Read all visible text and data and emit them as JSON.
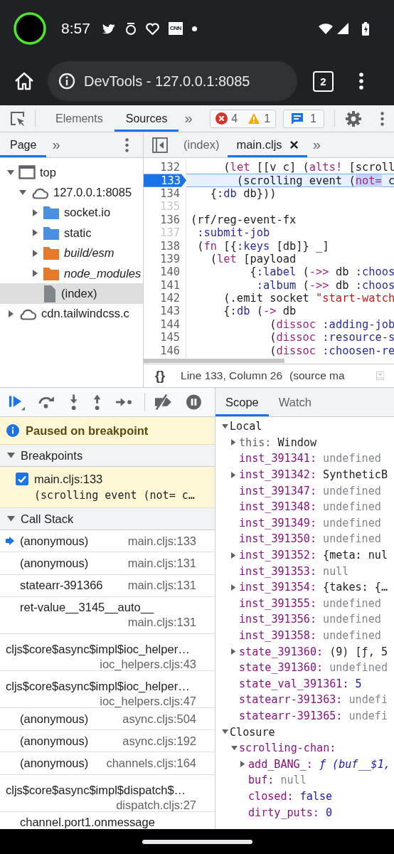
{
  "phone_status": {
    "time": "8:57",
    "app_icons": [
      {
        "kind": "bird"
      },
      {
        "kind": "ring"
      },
      {
        "kind": "heart"
      },
      {
        "kind": "label",
        "text": "CNN"
      },
      {
        "kind": "dot"
      }
    ]
  },
  "browser": {
    "url": "DevTools - 127.0.0.1:8085",
    "tab_count": "2"
  },
  "devtools_toolbar": {
    "tabs": [
      {
        "label": "Elements",
        "selected": false
      },
      {
        "label": "Sources",
        "selected": true
      }
    ],
    "more": "»",
    "errors": "4",
    "warnings": "1",
    "messages": "1"
  },
  "navigator": {
    "tabs": [
      {
        "label": "Page",
        "selected": true
      }
    ],
    "more": "»",
    "tree": [
      {
        "label": "top",
        "kind": "frame",
        "expanded": true,
        "selected": false,
        "children": [
          {
            "label": "127.0.0.1:8085",
            "kind": "cloud",
            "expanded": true,
            "selected": false,
            "children": [
              {
                "label": "socket.io",
                "kind": "folder",
                "expanded": false,
                "selected": false
              },
              {
                "label": "static",
                "kind": "folder",
                "expanded": false,
                "selected": false
              },
              {
                "label": "build/esm",
                "kind": "mapped-folder",
                "expanded": false,
                "selected": false
              },
              {
                "label": "node_modules",
                "kind": "mapped-folder",
                "expanded": false,
                "selected": false
              },
              {
                "label": "(index)",
                "kind": "file",
                "selected": true
              }
            ]
          }
        ]
      },
      {
        "label": "cdn.tailwindcss.c",
        "kind": "cloud",
        "expanded": false,
        "selected": false
      }
    ]
  },
  "editor": {
    "tabs": [
      {
        "label": "(index)",
        "selected": false,
        "closable": false
      },
      {
        "label": "main.cljs",
        "selected": true,
        "closable": true
      }
    ],
    "more": "»",
    "lines": [
      {
        "number": "132",
        "current": false,
        "muted": false,
        "tokens": [
          {
            "text": "     (",
            "kind": "plain"
          },
          {
            "text": "let",
            "kind": "builtin"
          },
          {
            "text": " [[v c] (",
            "kind": "plain"
          },
          {
            "text": "alts!",
            "kind": "builtin"
          },
          {
            "text": " [scroll",
            "kind": "plain"
          }
        ]
      },
      {
        "number": "133",
        "current": true,
        "muted": false,
        "tokens": [
          {
            "text": "       (scrolling event (",
            "kind": "plain"
          },
          {
            "text": "not=",
            "kind": "builtin",
            "highlighted": true
          },
          {
            "text": " c",
            "kind": "plain"
          }
        ]
      },
      {
        "number": "134",
        "current": false,
        "muted": false,
        "tokens": [
          {
            "text": "   {",
            "kind": "plain"
          },
          {
            "text": ":db",
            "kind": "atom"
          },
          {
            "text": " db}))",
            "kind": "plain"
          }
        ]
      },
      {
        "number": "135",
        "current": false,
        "muted": true
      },
      {
        "number": "136",
        "current": false,
        "muted": false,
        "tokens": [
          {
            "text": "(rf/reg-event-fx",
            "kind": "plain"
          }
        ]
      },
      {
        "number": "137",
        "current": false,
        "muted": true,
        "tokens": [
          {
            "text": " :submit-job",
            "kind": "atom"
          }
        ]
      },
      {
        "number": "138",
        "current": false,
        "muted": false,
        "tokens": [
          {
            "text": " (",
            "kind": "plain"
          },
          {
            "text": "fn",
            "kind": "builtin"
          },
          {
            "text": " [{",
            "kind": "plain"
          },
          {
            "text": ":keys",
            "kind": "atom"
          },
          {
            "text": " [db]} _]",
            "kind": "plain"
          }
        ]
      },
      {
        "number": "139",
        "current": false,
        "muted": false,
        "tokens": [
          {
            "text": "   (",
            "kind": "plain"
          },
          {
            "text": "let",
            "kind": "builtin"
          },
          {
            "text": " [payload",
            "kind": "plain"
          }
        ]
      },
      {
        "number": "140",
        "current": false,
        "muted": false,
        "tokens": [
          {
            "text": "         {",
            "kind": "plain"
          },
          {
            "text": ":label",
            "kind": "atom"
          },
          {
            "text": " (",
            "kind": "plain"
          },
          {
            "text": "->>",
            "kind": "builtin"
          },
          {
            "text": " db ",
            "kind": "plain"
          },
          {
            "text": ":choos",
            "kind": "atom"
          }
        ]
      },
      {
        "number": "141",
        "current": false,
        "muted": false,
        "tokens": [
          {
            "text": "          :album",
            "kind": "atom"
          },
          {
            "text": " (",
            "kind": "plain"
          },
          {
            "text": "->>",
            "kind": "builtin"
          },
          {
            "text": " db ",
            "kind": "plain"
          },
          {
            "text": ":choos",
            "kind": "atom"
          }
        ]
      },
      {
        "number": "142",
        "current": false,
        "muted": false,
        "tokens": [
          {
            "text": "     (.emit socket ",
            "kind": "plain"
          },
          {
            "text": "\"start-watch",
            "kind": "string"
          }
        ]
      },
      {
        "number": "143",
        "current": false,
        "muted": false,
        "tokens": [
          {
            "text": "     {",
            "kind": "plain"
          },
          {
            "text": ":db",
            "kind": "atom"
          },
          {
            "text": " (",
            "kind": "plain"
          },
          {
            "text": "->",
            "kind": "builtin"
          },
          {
            "text": " db",
            "kind": "plain"
          }
        ]
      },
      {
        "number": "144",
        "current": false,
        "muted": false,
        "tokens": [
          {
            "text": "            (",
            "kind": "plain"
          },
          {
            "text": "dissoc",
            "kind": "builtin"
          },
          {
            "text": " :adding-job",
            "kind": "atom"
          }
        ]
      },
      {
        "number": "145",
        "current": false,
        "muted": false,
        "tokens": [
          {
            "text": "            (",
            "kind": "plain"
          },
          {
            "text": "dissoc",
            "kind": "builtin"
          },
          {
            "text": " :resource-s",
            "kind": "atom"
          }
        ]
      },
      {
        "number": "146",
        "current": false,
        "muted": false,
        "tokens": [
          {
            "text": "            (",
            "kind": "plain"
          },
          {
            "text": "dissoc",
            "kind": "builtin"
          },
          {
            "text": " :choosen-re",
            "kind": "atom"
          }
        ]
      }
    ],
    "format_button": "{}",
    "cursor_position": "Line 133, Column 26",
    "source_map_note": "(source ma"
  },
  "debugger": {
    "paused_message": "Paused on breakpoint",
    "breakpoints": {
      "title": "Breakpoints",
      "expanded": true,
      "items": [
        {
          "location": "main.cljs:133",
          "code": "(scrolling event (not= c…",
          "checked": true
        }
      ]
    },
    "call_stack": {
      "title": "Call Stack",
      "expanded": true,
      "frames": [
        {
          "name": "(anonymous)",
          "location": "main.cljs:133",
          "kind": "inline",
          "current": true
        },
        {
          "name": "(anonymous)",
          "location": "main.cljs:131",
          "kind": "inline",
          "current": false
        },
        {
          "name": "statearr-391366",
          "location": "main.cljs:131",
          "kind": "inline",
          "current": false
        },
        {
          "name": "ret-value__3145__auto__",
          "location": "main.cljs:131",
          "kind": "stacked",
          "current": false
        },
        {
          "name": "cljs$core$async$impl$ioc_helper…",
          "location": "ioc_helpers.cljs:43",
          "kind": "stacked",
          "current": false
        },
        {
          "name": "cljs$core$async$impl$ioc_helper…",
          "location": "ioc_helpers.cljs:47",
          "kind": "stacked",
          "current": false
        },
        {
          "name": "(anonymous)",
          "location": "async.cljs:504",
          "kind": "inline",
          "current": false
        },
        {
          "name": "(anonymous)",
          "location": "async.cljs:192",
          "kind": "inline",
          "current": false
        },
        {
          "name": "(anonymous)",
          "location": "channels.cljs:164",
          "kind": "inline",
          "current": false
        },
        {
          "name": "cljs$core$async$impl$dispatch$…",
          "location": "dispatch.cljs:27",
          "kind": "stacked",
          "current": false
        },
        {
          "name": "channel.port1.onmessage",
          "kind": "inline",
          "current": false
        }
      ]
    }
  },
  "scope_panel": {
    "tabs": [
      {
        "label": "Scope",
        "selected": true
      },
      {
        "label": "Watch",
        "selected": false
      }
    ],
    "tree": [
      {
        "name": "Local",
        "kind": "section",
        "expanded": true,
        "children": [
          {
            "name": "this:",
            "kind": "plain",
            "value": {
              "text": "Window",
              "kind": "object"
            },
            "expanded": false
          },
          {
            "name": "inst_391341:",
            "kind": "property",
            "value": {
              "text": "undefined",
              "kind": "undefined"
            }
          },
          {
            "name": "inst_391342:",
            "kind": "property",
            "value": {
              "text": "SyntheticB",
              "kind": "object"
            },
            "expanded": false
          },
          {
            "name": "inst_391347:",
            "kind": "property",
            "value": {
              "text": "undefined",
              "kind": "undefined"
            }
          },
          {
            "name": "inst_391348:",
            "kind": "property",
            "value": {
              "text": "undefined",
              "kind": "undefined"
            }
          },
          {
            "name": "inst_391349:",
            "kind": "property",
            "value": {
              "text": "undefined",
              "kind": "undefined"
            }
          },
          {
            "name": "inst_391350:",
            "kind": "property",
            "value": {
              "text": "undefined",
              "kind": "undefined"
            }
          },
          {
            "name": "inst_391352:",
            "kind": "property",
            "value": {
              "text": "{meta: nul",
              "kind": "object"
            },
            "expanded": false
          },
          {
            "name": "inst_391353:",
            "kind": "property",
            "value": {
              "text": "null",
              "kind": "null"
            }
          },
          {
            "name": "inst_391354:",
            "kind": "property",
            "value": {
              "text": "{takes: {…",
              "kind": "object"
            },
            "expanded": false
          },
          {
            "name": "inst_391355:",
            "kind": "property",
            "value": {
              "text": "undefined",
              "kind": "undefined"
            }
          },
          {
            "name": "inst_391356:",
            "kind": "property",
            "value": {
              "text": "undefined",
              "kind": "undefined"
            }
          },
          {
            "name": "inst_391358:",
            "kind": "property",
            "value": {
              "text": "undefined",
              "kind": "undefined"
            }
          },
          {
            "name": "state_391360:",
            "kind": "property",
            "value": {
              "text": "(9) [ƒ, 5",
              "kind": "object"
            },
            "expanded": false
          },
          {
            "name": "state_391360:",
            "kind": "property",
            "value": {
              "text": "undefined",
              "kind": "undefined"
            }
          },
          {
            "name": "state_val_391361:",
            "kind": "property",
            "value": {
              "text": "5",
              "kind": "number"
            }
          },
          {
            "name": "statearr-391363:",
            "kind": "property",
            "value": {
              "text": "undefi",
              "kind": "undefined"
            }
          },
          {
            "name": "statearr-391365:",
            "kind": "property",
            "value": {
              "text": "undefi",
              "kind": "undefined"
            }
          }
        ]
      },
      {
        "name": "Closure",
        "kind": "section",
        "expanded": true,
        "children": [
          {
            "name": "scrolling-chan:",
            "kind": "property",
            "expanded": true,
            "children": [
              {
                "name": "add_BANG_:",
                "kind": "property",
                "value": {
                  "text": "ƒ (buf__$1,",
                  "kind": "function"
                },
                "expanded": false
              },
              {
                "name": "buf:",
                "kind": "property",
                "value": {
                  "text": "null",
                  "kind": "null"
                }
              },
              {
                "name": "closed:",
                "kind": "property",
                "value": {
                  "text": "false",
                  "kind": "boolean"
                }
              },
              {
                "name": "dirty_puts:",
                "kind": "property",
                "value": {
                  "text": "0",
                  "kind": "number"
                }
              }
            ]
          }
        ]
      }
    ]
  }
}
